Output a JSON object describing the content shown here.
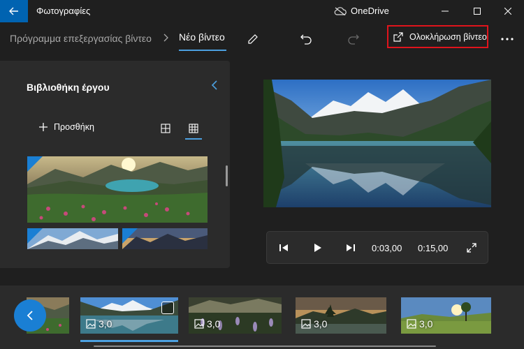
{
  "titlebar": {
    "app_title": "Φωτογραφίες",
    "onedrive_label": "OneDrive",
    "accent": "#0063b1"
  },
  "toolbar": {
    "breadcrumb_parent": "Πρόγραμμα επεξεργασίας βίντεο",
    "breadcrumb_current": "Νέο βίντεο",
    "finish_label": "Ολοκλήρωση βίντεο",
    "highlight_color": "#e0141c"
  },
  "library": {
    "title": "Βιβλιοθήκη έργου",
    "add_label": "Προσθήκη"
  },
  "player": {
    "current_time": "0:03,00",
    "total_time": "0:15,00"
  },
  "storyboard": {
    "clips": [
      {
        "duration": "3,0"
      },
      {
        "duration": "3,0"
      },
      {
        "duration": "3,0"
      },
      {
        "duration": "3,0"
      }
    ]
  }
}
